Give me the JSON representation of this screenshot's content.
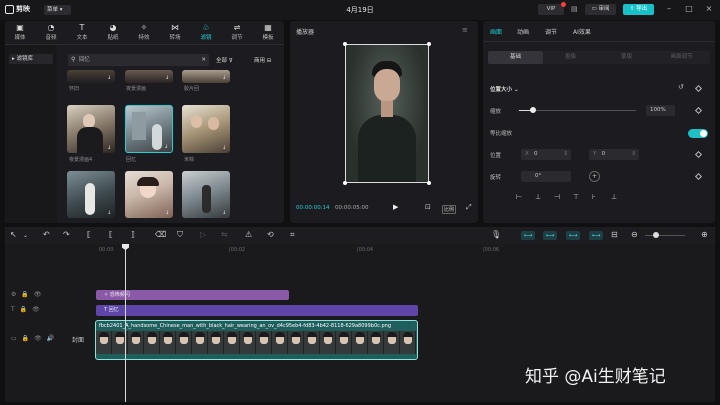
{
  "app": {
    "name": "剪映",
    "menu": "菜单",
    "title": "4月19日",
    "vip": "VIP",
    "review": "审阅",
    "export": "导出"
  },
  "media_tabs": [
    {
      "label": "媒体",
      "icon": "media-icon"
    },
    {
      "label": "音频",
      "icon": "audio-icon"
    },
    {
      "label": "文本",
      "icon": "text-icon"
    },
    {
      "label": "贴纸",
      "icon": "sticker-icon"
    },
    {
      "label": "特效",
      "icon": "effects-icon"
    },
    {
      "label": "转场",
      "icon": "transition-icon"
    },
    {
      "label": "滤镜",
      "icon": "filter-icon",
      "active": true
    },
    {
      "label": "调节",
      "icon": "adjust-icon"
    },
    {
      "label": "模板",
      "icon": "template-icon"
    }
  ],
  "library": {
    "category": "滤镜库",
    "search_value": "回忆",
    "filter_all": "全部",
    "filter_commercial": "商用",
    "items": [
      {
        "label": "怀旧"
      },
      {
        "label": "夜景漫画"
      },
      {
        "label": "胶片回"
      },
      {
        "label": "夜景漫画4"
      },
      {
        "label": "回忆"
      },
      {
        "label": "米棕"
      },
      {
        "label": ""
      },
      {
        "label": ""
      },
      {
        "label": ""
      }
    ]
  },
  "player": {
    "title": "播放器",
    "time_current": "00:00:00:14",
    "time_total": "00:00:05:00",
    "ratio": "比例"
  },
  "props": {
    "tabs": [
      "画面",
      "动画",
      "调节",
      "AI效果"
    ],
    "subtabs": [
      "基础",
      "抠像",
      "蒙版",
      "画面调节"
    ],
    "section": "位置大小",
    "scale_label": "缩放",
    "scale_value": "100%",
    "scale_fraction": 0.12,
    "uniform_label": "等比缩放",
    "position_label": "位置",
    "pos_x_label": "X",
    "pos_x": "0",
    "pos_y_label": "Y",
    "pos_y": "0",
    "rotate_label": "旋转",
    "rotate_value": "0°"
  },
  "timeline": {
    "ruler": [
      "00:00",
      "|00:02",
      "|00:04",
      "|00:06"
    ],
    "clip_effect": "恐怖频闪",
    "clip_text": "回忆",
    "clip_video": "fbcb2401_A_handsome_Chinese_man_with_black_hair_wearing_an_ov_d4c95eb4-fd83-4b42-8118-629a8099b0c.png",
    "cover": "封面"
  },
  "watermark": "知乎 @Ai生财笔记",
  "colors": {
    "accent": "#1fd0d6",
    "export": "#18c1c9",
    "effect_clip": "#8a5aa8",
    "text_clip": "#5f45a8",
    "video_clip": "#1e5e5c"
  }
}
